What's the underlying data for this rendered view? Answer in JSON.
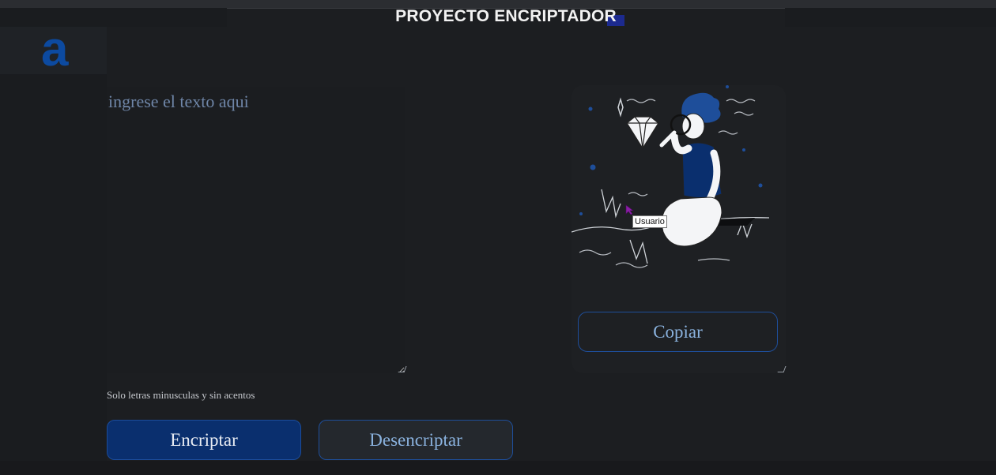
{
  "header": {
    "title": "PROYECTO ENCRIPTADOR"
  },
  "logo": {
    "glyph": "a",
    "icon": "alura-logo-icon",
    "color": "#0c4aa0"
  },
  "input": {
    "placeholder": "ingrese el texto aqui",
    "value": ""
  },
  "hint": "Solo letras minusculas y sin acentos",
  "buttons": {
    "encrypt_label": "Encriptar",
    "decrypt_label": "Desencriptar",
    "copy_label": "Copiar"
  },
  "tooltip": {
    "text": "Usuario"
  },
  "illustration": {
    "icon": "person-with-magnifier-and-diamond-illustration"
  },
  "colors": {
    "background": "#1c1e21",
    "accent": "#0a2f6e",
    "accent_border": "#1e4e9a",
    "secondary_text": "#8ab2de"
  }
}
